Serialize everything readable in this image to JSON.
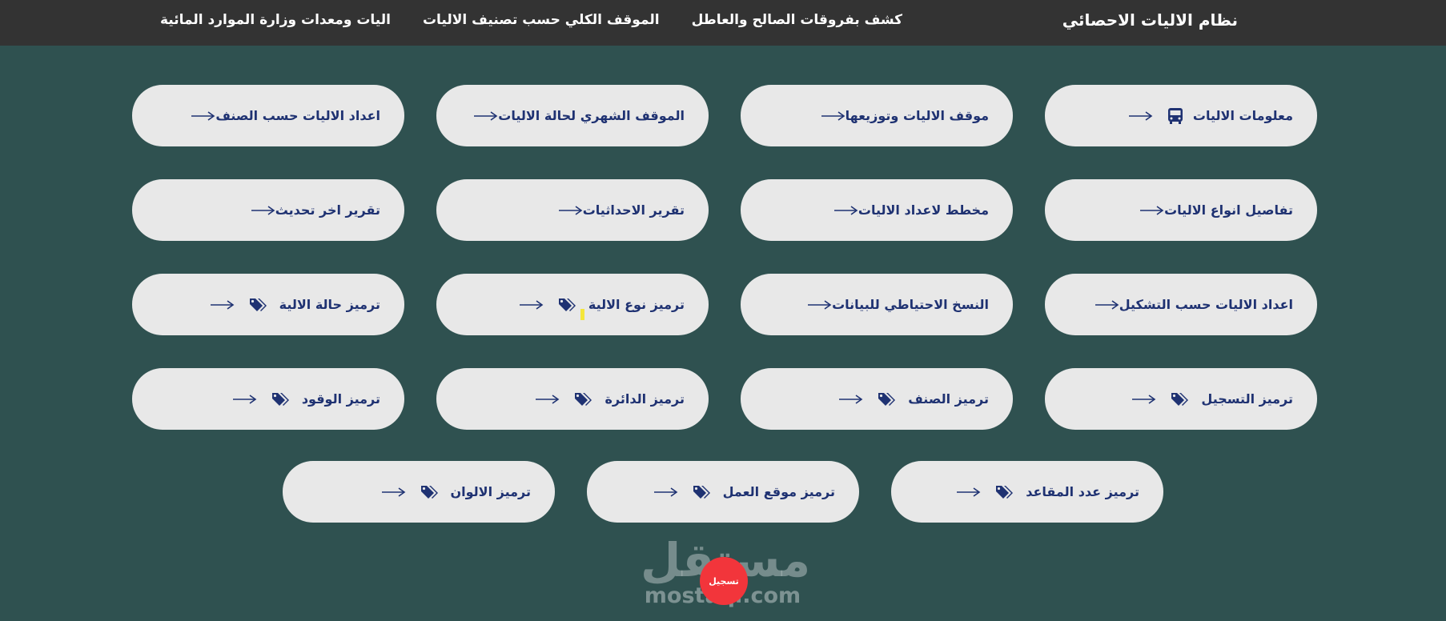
{
  "header": {
    "brand": "نظام الاليات الاحصائي",
    "nav": [
      "كشف بفروقات الصالح والعاطل",
      "الموقف الكلي حسب تصنيف الاليات",
      "اليات ومعدات وزارة الموارد المائية"
    ]
  },
  "buttons": [
    {
      "label": "معلومات الاليات",
      "icon": "bus-icon"
    },
    {
      "label": "موقف الاليات وتوزيعها",
      "icon": ""
    },
    {
      "label": "الموقف الشهري لحالة الاليات",
      "icon": ""
    },
    {
      "label": "اعداد الاليات حسب الصنف",
      "icon": ""
    },
    {
      "label": "تفاصيل انواع الاليات",
      "icon": ""
    },
    {
      "label": "مخطط لاعداد الاليات",
      "icon": ""
    },
    {
      "label": "تقرير الاحداثيات",
      "icon": ""
    },
    {
      "label": "تقرير اخر تحديث",
      "icon": ""
    },
    {
      "label": "اعداد الاليات حسب التشكيل",
      "icon": ""
    },
    {
      "label": "النسخ الاحتياطي للبيانات",
      "icon": ""
    },
    {
      "label": "ترميز نوع الالية",
      "icon": "tags-icon"
    },
    {
      "label": "ترميز حالة الالية",
      "icon": "tags-icon"
    },
    {
      "label": "ترميز التسجيل",
      "icon": "tags-icon"
    },
    {
      "label": "ترميز الصنف",
      "icon": "tags-icon"
    },
    {
      "label": "ترميز الدائرة",
      "icon": "tags-icon"
    },
    {
      "label": "ترميز الوقود",
      "icon": "tags-icon"
    },
    {
      "label": "ترميز عدد المقاعد",
      "icon": "tags-icon"
    },
    {
      "label": "ترميز موقع العمل",
      "icon": "tags-icon"
    },
    {
      "label": "ترميز الالوان",
      "icon": "tags-icon"
    }
  ],
  "watermark": {
    "logo": "مستقل",
    "url": "mostaql.com",
    "record_badge": "تسجيل"
  },
  "colors": {
    "background": "#2f5150",
    "topbar": "#333333",
    "button_bg": "#e8e8e8",
    "button_text": "#1f3272"
  }
}
